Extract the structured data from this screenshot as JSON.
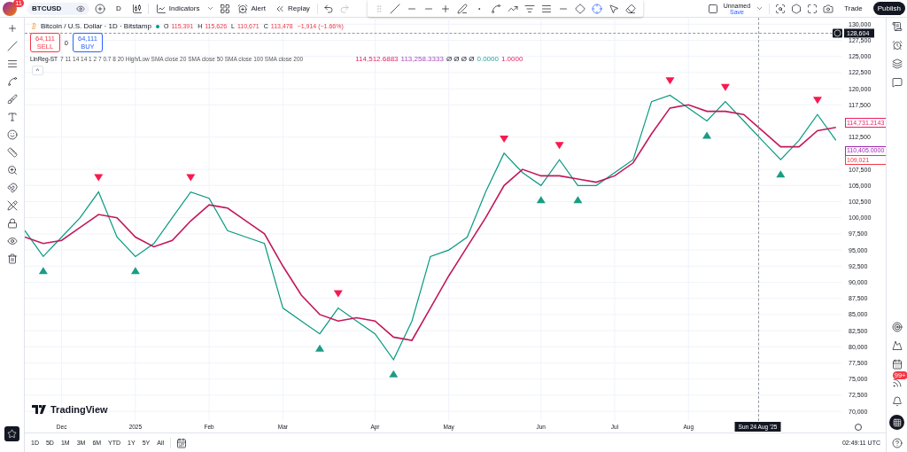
{
  "top_bar": {
    "avatar_badge": "11",
    "symbol": "BTCUSD",
    "interval": "D",
    "buttons": [
      {
        "kind": "indicators",
        "label": "Indicators"
      },
      {
        "kind": "alert",
        "label": "Alert"
      },
      {
        "kind": "replay",
        "label": "Replay"
      }
    ],
    "layout_name": "Unnamed",
    "save_label": "Save",
    "trade": "Trade",
    "publish": "Publish"
  },
  "legend": {
    "title": "Bitcoin / U.S. Dollar · 1D · Bitstamp",
    "ohlc": [
      {
        "key": "O",
        "value": "115,391"
      },
      {
        "key": "H",
        "value": "115,626"
      },
      {
        "key": "L",
        "value": "110,671"
      },
      {
        "key": "C",
        "value": "113,478"
      }
    ],
    "change": "−1,914 (−1.66%)",
    "sell": {
      "price": "64,111",
      "label": "SELL"
    },
    "spread": "0",
    "buy": {
      "price": "64,111",
      "label": "BUY"
    },
    "indicator": {
      "name": "LinReg-ST",
      "params": "7 11 14 14 1 2 7 0.7 8 20 High/Low SMA close 20 SMA close 50 SMA close 100 SMA close 200",
      "values": [
        "114,512.6883",
        "113,258.3333",
        "Ø Ø Ø Ø",
        "0.0000",
        "1.0000"
      ]
    },
    "collapse": "^"
  },
  "watermark_logo": "TradingView",
  "chart": {
    "chart_data": {
      "type": "line",
      "ylim": [
        68500,
        131000
      ],
      "categories": [
        null,
        null,
        "Dec",
        null,
        null,
        null,
        "2025",
        null,
        null,
        null,
        "Feb",
        null,
        null,
        null,
        "Mar",
        null,
        null,
        null,
        null,
        "Apr",
        null,
        null,
        null,
        "May",
        null,
        null,
        null,
        null,
        "Jun",
        null,
        null,
        null,
        "Jul",
        null,
        null,
        null,
        "Aug",
        null,
        null,
        null,
        null,
        null,
        null,
        null,
        null
      ],
      "series": [
        {
          "color": "#089981",
          "values": [
            98000,
            94000,
            97000,
            100000,
            104000,
            97000,
            94000,
            96000,
            100000,
            104000,
            103000,
            98000,
            97000,
            96000,
            86000,
            84000,
            82000,
            86000,
            84000,
            82000,
            78000,
            84000,
            94000,
            95000,
            97000,
            104000,
            110000,
            107000,
            105000,
            109000,
            105000,
            105000,
            107000,
            109000,
            118000,
            119000,
            117000,
            115000,
            118000,
            115000,
            112000,
            109000,
            112000,
            116000,
            112000
          ]
        },
        {
          "color": "#c2185b",
          "values": [
            97000,
            96000,
            96500,
            98500,
            100500,
            100000,
            97000,
            95500,
            96500,
            99500,
            102000,
            101500,
            99500,
            97500,
            92500,
            88000,
            85000,
            84000,
            84500,
            84000,
            81500,
            81000,
            86000,
            91000,
            95500,
            100000,
            105000,
            107500,
            106500,
            106500,
            106000,
            105500,
            106500,
            108500,
            113000,
            117000,
            117500,
            116500,
            116500,
            116000,
            113500,
            111000,
            111000,
            113500,
            114000
          ]
        }
      ],
      "yticks": [
        {
          "value": 70000,
          "label": "70,000"
        },
        {
          "value": 72500,
          "label": "72,500"
        },
        {
          "value": 75000,
          "label": "75,000"
        },
        {
          "value": 77500,
          "label": "77,500"
        },
        {
          "value": 80000,
          "label": "80,000"
        },
        {
          "value": 82500,
          "label": "82,500"
        },
        {
          "value": 85000,
          "label": "85,000"
        },
        {
          "value": 87500,
          "label": "87,500"
        },
        {
          "value": 90000,
          "label": "90,000"
        },
        {
          "value": 92500,
          "label": "92,500"
        },
        {
          "value": 95000,
          "label": "95,000"
        },
        {
          "value": 97500,
          "label": "97,500"
        },
        {
          "value": 100000,
          "label": "100,000"
        },
        {
          "value": 102500,
          "label": "102,500"
        },
        {
          "value": 105000,
          "label": "105,000"
        },
        {
          "value": 107500,
          "label": "107,500"
        },
        {
          "value": 112500,
          "label": "112,500"
        },
        {
          "value": 117500,
          "label": "117,500"
        },
        {
          "value": 120000,
          "label": "120,000"
        },
        {
          "value": 122500,
          "label": "122,500"
        },
        {
          "value": 125000,
          "label": "125,000"
        },
        {
          "value": 127500,
          "label": "127,500"
        },
        {
          "value": 130000,
          "label": "130,000"
        }
      ],
      "grid": true
    },
    "price_tags": [
      {
        "label": "114,731.2143",
        "color": "#e91e63"
      },
      {
        "label": "110,405.0000",
        "color": "#9c27b0"
      },
      {
        "label": "109,021",
        "color": "#f23645"
      }
    ],
    "crosshair": {
      "price_label": "128,604",
      "time_label": "Sun 24 Aug '25"
    }
  },
  "right_sidebar": {
    "notification_badge": "99+"
  },
  "bottom_bar": {
    "ranges": [
      {
        "label": "1D"
      },
      {
        "label": "5D"
      },
      {
        "label": "1M"
      },
      {
        "label": "3M"
      },
      {
        "label": "6M"
      },
      {
        "label": "YTD"
      },
      {
        "label": "1Y"
      },
      {
        "label": "5Y"
      },
      {
        "label": "All"
      }
    ],
    "clock": "02:49:11 UTC"
  }
}
